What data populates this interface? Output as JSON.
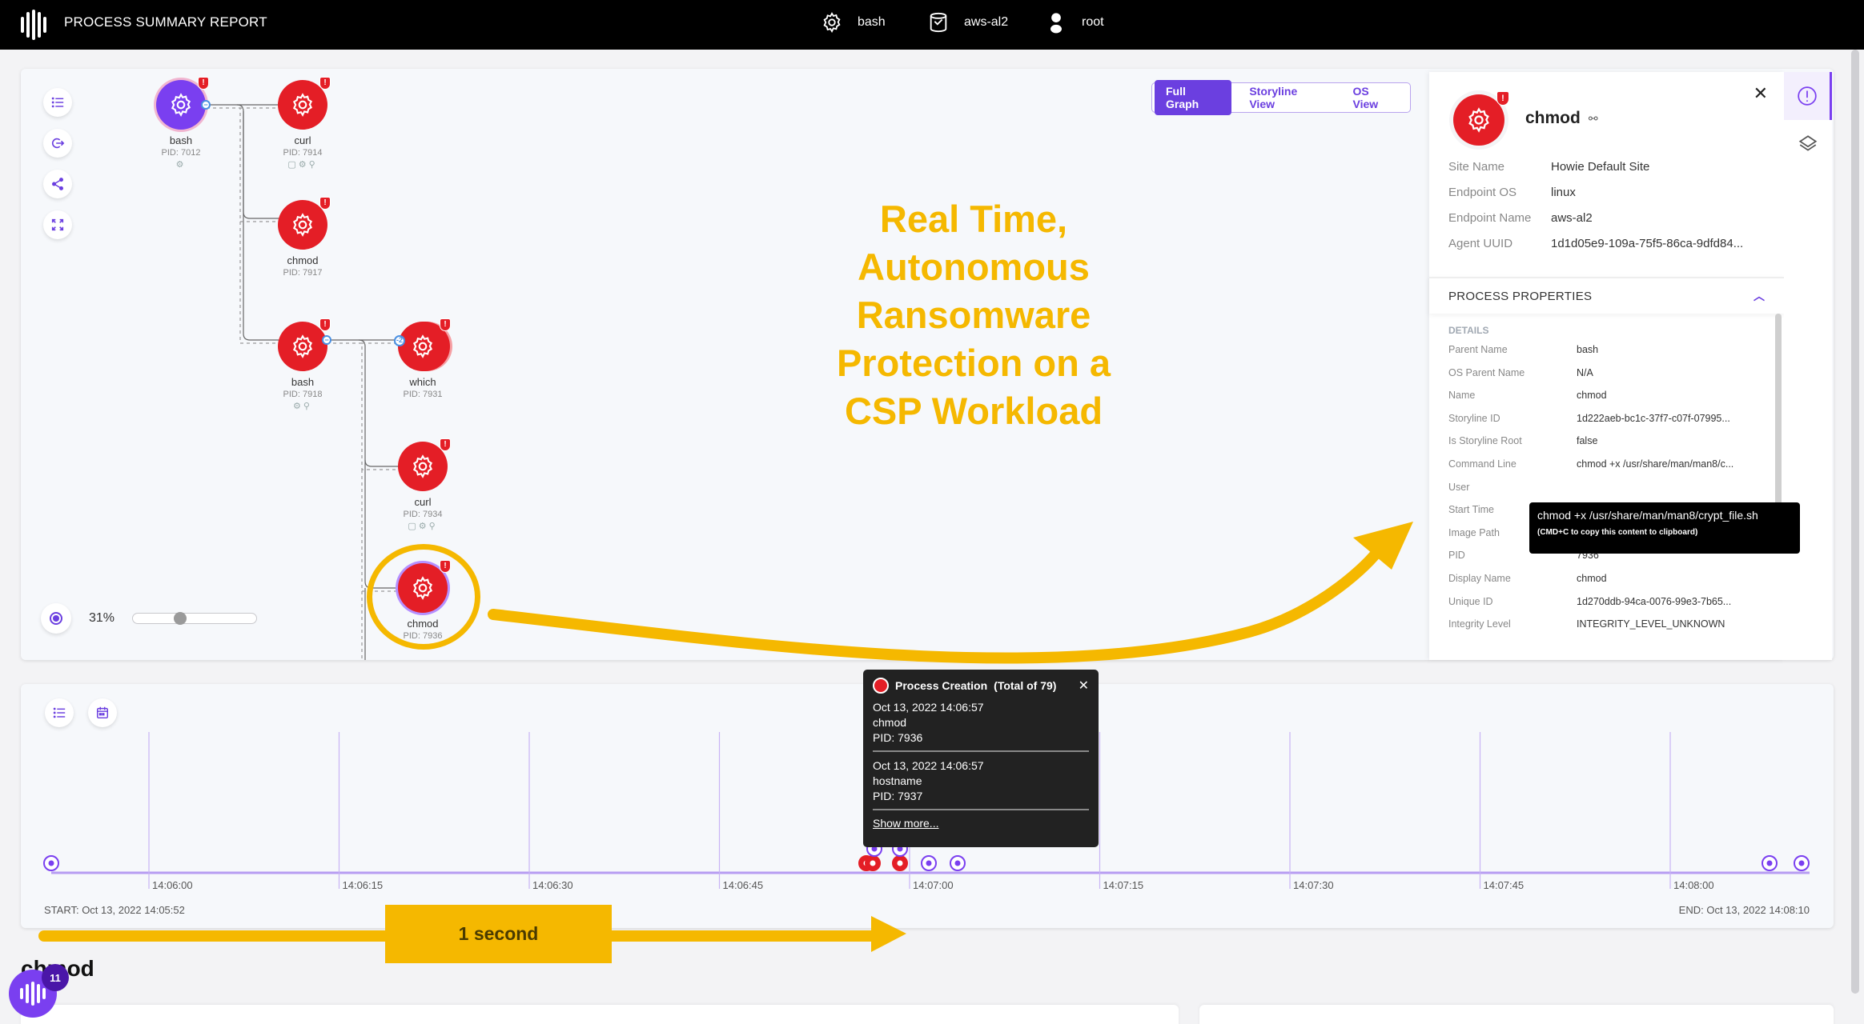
{
  "topbar": {
    "title": "PROCESS SUMMARY REPORT",
    "context": [
      {
        "icon": "gear-icon",
        "label": "bash"
      },
      {
        "icon": "endpoint-icon",
        "label": "aws-al2"
      },
      {
        "icon": "user-icon",
        "label": "root"
      }
    ]
  },
  "graph": {
    "view_toggle": [
      "Full Graph",
      "Storyline View",
      "OS View"
    ],
    "active_view": "Full Graph",
    "zoom_level": "31%",
    "zoom_fraction": 0.31,
    "nodes": [
      {
        "name": "bash",
        "pid": "PID: 7012",
        "type": "root"
      },
      {
        "name": "curl",
        "pid": "PID: 7914",
        "type": "alert"
      },
      {
        "name": "chmod",
        "pid": "PID: 7917",
        "type": "alert"
      },
      {
        "name": "bash",
        "pid": "PID: 7918",
        "type": "alert"
      },
      {
        "name": "which",
        "pid": "PID: 7931",
        "type": "alert"
      },
      {
        "name": "curl",
        "pid": "PID: 7934",
        "type": "alert"
      },
      {
        "name": "chmod",
        "pid": "PID: 7936",
        "type": "alert-selected"
      }
    ],
    "collapse_counts": [
      "-2"
    ],
    "alert_mark": "!"
  },
  "annotation": {
    "headline": [
      "Real Time,",
      "Autonomous",
      "Ransomware",
      "Protection on a",
      "CSP Workload"
    ],
    "duration_label": "1 second",
    "accent_color": "#f5b800"
  },
  "detail": {
    "title": "chmod",
    "close": "✕",
    "summary": [
      {
        "k": "Site Name",
        "v": "Howie Default Site"
      },
      {
        "k": "Endpoint OS",
        "v": "linux"
      },
      {
        "k": "Endpoint Name",
        "v": "aws-al2"
      },
      {
        "k": "Agent UUID",
        "v": "1d1d05e9-109a-75f5-86ca-9dfd84..."
      }
    ],
    "section_title": "PROCESS PROPERTIES",
    "details_heading": "DETAILS",
    "properties": [
      {
        "k": "Parent Name",
        "v": "bash"
      },
      {
        "k": "OS Parent Name",
        "v": "N/A"
      },
      {
        "k": "Name",
        "v": "chmod"
      },
      {
        "k": "Storyline ID",
        "v": "1d222aeb-bc1c-37f7-c07f-07995..."
      },
      {
        "k": "Is Storyline Root",
        "v": "false"
      },
      {
        "k": "Command Line",
        "v": "chmod +x /usr/share/man/man8/c..."
      },
      {
        "k": "User",
        "v": ""
      },
      {
        "k": "Start Time",
        "v": ""
      },
      {
        "k": "Image Path",
        "v": ""
      },
      {
        "k": "PID",
        "v": "7936"
      },
      {
        "k": "Display Name",
        "v": "chmod"
      },
      {
        "k": "Unique ID",
        "v": "1d270ddb-94ca-0076-99e3-7b65..."
      },
      {
        "k": "Integrity Level",
        "v": "INTEGRITY_LEVEL_UNKNOWN"
      }
    ],
    "tooltip": {
      "text": "chmod +x /usr/share/man/man8/crypt_file.sh",
      "hint": "(CMD+C to copy this content to clipboard)"
    }
  },
  "timeline": {
    "ticks": [
      "14:06:00",
      "14:06:15",
      "14:06:30",
      "14:06:45",
      "14:07:00",
      "14:07:15",
      "14:07:30",
      "14:07:45",
      "14:08:00"
    ],
    "start": "START: Oct 13, 2022 14:05:52",
    "end": "END: Oct 13, 2022 14:08:10",
    "popup": {
      "title": "Process Creation",
      "total": "(Total of 79)",
      "close": "✕",
      "entries": [
        {
          "time": "Oct 13, 2022 14:06:57",
          "name": "chmod",
          "pid": "PID: 7936"
        },
        {
          "time": "Oct 13, 2022 14:06:57",
          "name": "hostname",
          "pid": "PID: 7937"
        }
      ],
      "show_more": "Show more..."
    }
  },
  "footer": {
    "title": "chmod",
    "notification_count": "11"
  },
  "colors": {
    "brand_purple": "#7a3ff0",
    "alert_red": "#e41e26",
    "highlight_yellow": "#f5b800"
  }
}
